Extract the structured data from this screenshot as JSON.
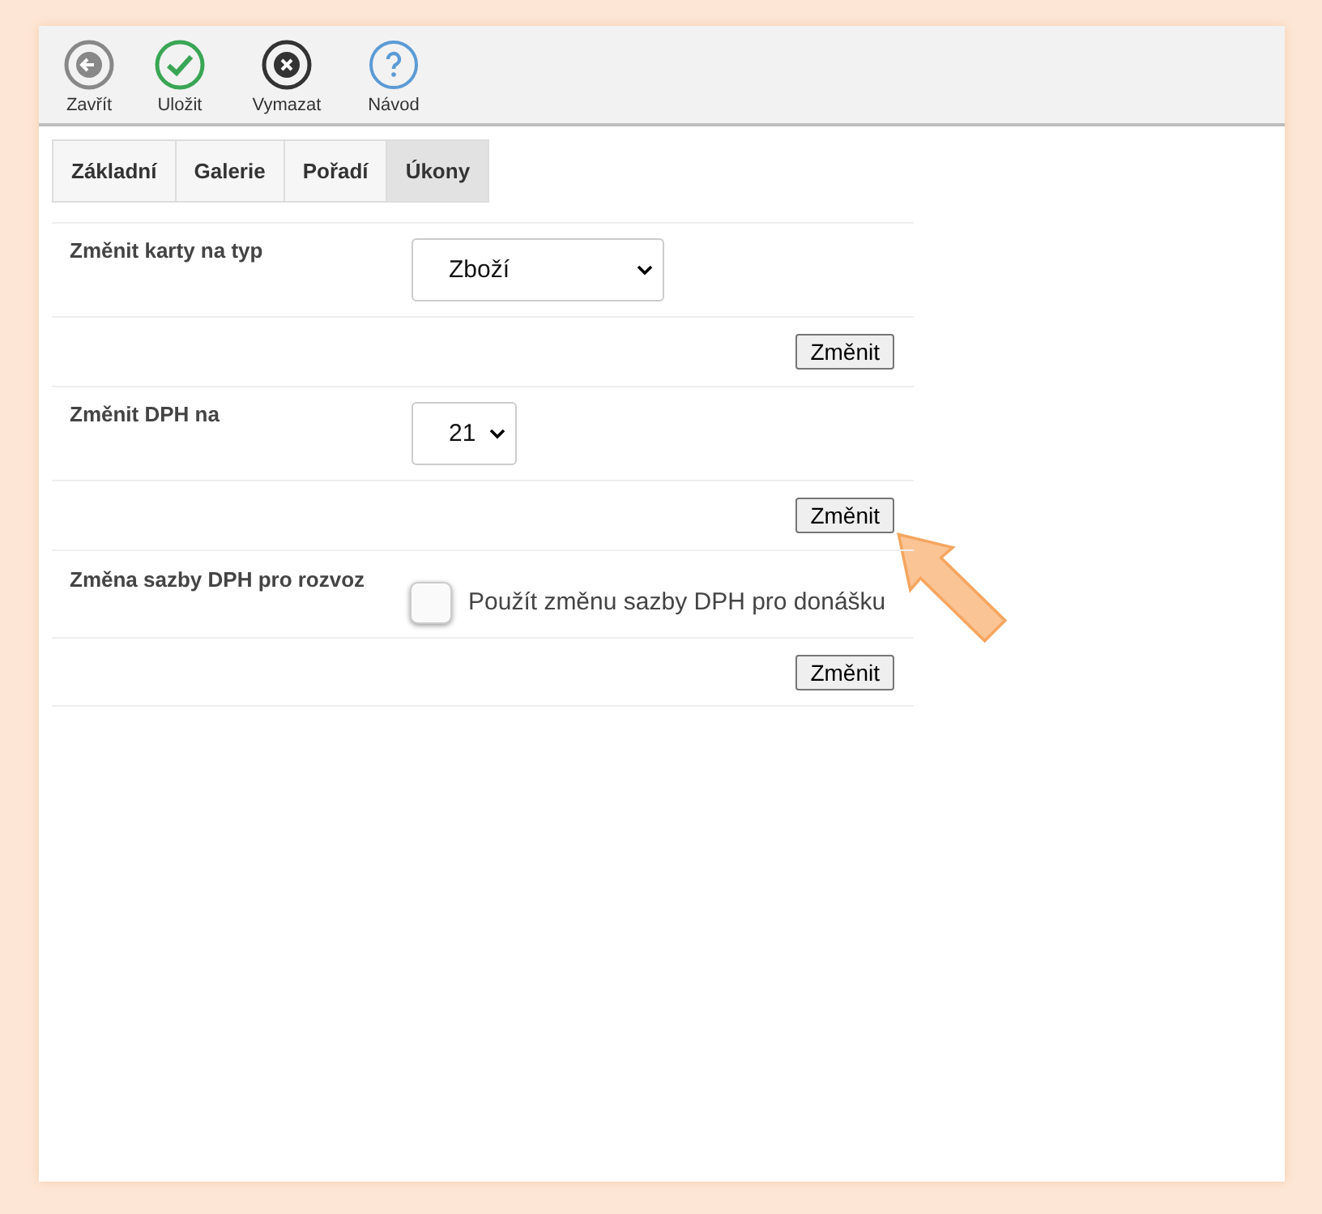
{
  "toolbar": [
    {
      "kind": "back",
      "label": "Zavřít"
    },
    {
      "kind": "save",
      "label": "Uložit"
    },
    {
      "kind": "delete",
      "label": "Vymazat"
    },
    {
      "kind": "help",
      "label": "Návod"
    }
  ],
  "tabs": [
    {
      "label": "Základní",
      "selected": false
    },
    {
      "label": "Galerie",
      "selected": false
    },
    {
      "label": "Pořadí",
      "selected": false
    },
    {
      "label": "Úkony",
      "selected": true
    }
  ],
  "rows": [
    {
      "kind": "select",
      "label": "Změnit karty na typ",
      "value": "Zboží",
      "wide": true
    },
    {
      "kind": "button",
      "label": "Změnit",
      "highlighted": false
    },
    {
      "kind": "select",
      "label": "Změnit DPH na",
      "value": "21",
      "wide": false
    },
    {
      "kind": "button",
      "label": "Změnit",
      "highlighted": true
    },
    {
      "kind": "checkbox",
      "label": "Změna sazby DPH pro rozvoz",
      "option": "Použít změnu sazby DPH pro donášku",
      "checked": false
    },
    {
      "kind": "button",
      "label": "Změnit",
      "highlighted": false
    }
  ]
}
